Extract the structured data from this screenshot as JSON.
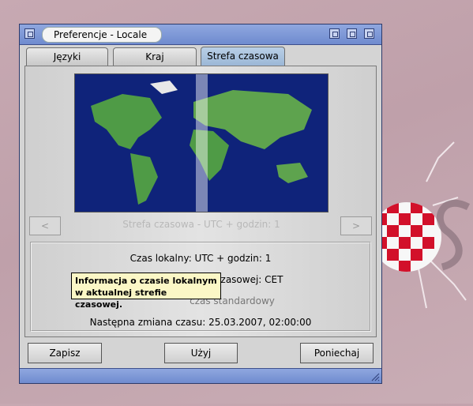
{
  "window": {
    "title": "Preferencje - Locale"
  },
  "tabs": [
    {
      "label": "Języki"
    },
    {
      "label": "Kraj"
    },
    {
      "label": "Strefa czasowa",
      "active": true
    }
  ],
  "timezone": {
    "prev_label": "<",
    "next_label": ">",
    "caption": "Strefa czasowa - UTC + godzin: 1"
  },
  "info": {
    "local_time": "Czas lokalny: UTC + godzin: 1",
    "zone_name_partial": "zasowej: CET",
    "time_type_partial": "czas standardowy",
    "next_change": "Następna zmiana czasu: 25.03.2007, 02:00:00"
  },
  "tooltip": {
    "line1": "Informacja o czasie lokalnym",
    "line2": "w aktualnej strefie czasowej."
  },
  "buttons": {
    "save": "Zapisz",
    "use": "Użyj",
    "cancel": "Poniechaj"
  },
  "colors": {
    "accent": "#7f98d7",
    "tooltip_bg": "#fbf7c6",
    "map_ocean": "#0f237a"
  }
}
